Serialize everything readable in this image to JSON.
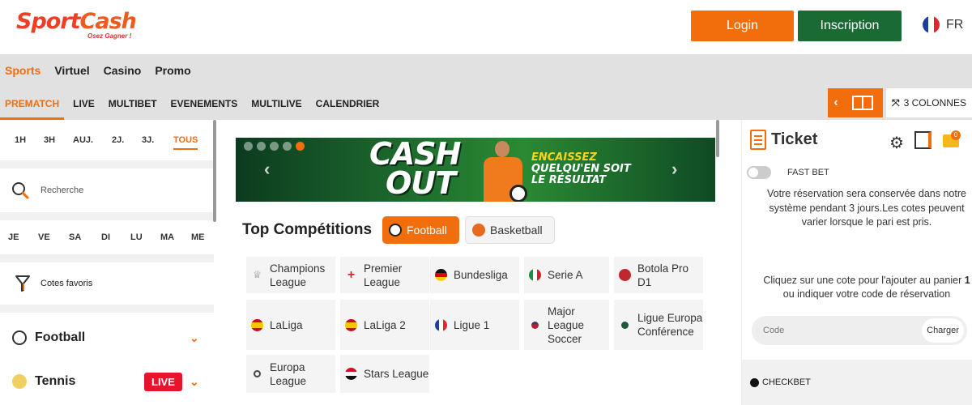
{
  "header": {
    "logo_text_1": "Sport",
    "logo_text_2": "Cash",
    "logo_tagline": "Osez Gagner !",
    "login": "Login",
    "signup": "Inscription",
    "language": "FR"
  },
  "nav_main": [
    "Sports",
    "Virtuel",
    "Casino",
    "Promo"
  ],
  "nav_sub": [
    "PREMATCH",
    "LIVE",
    "MULTIBET",
    "EVENEMENTS",
    "MULTILIVE",
    "CALENDRIER"
  ],
  "layout": {
    "columns_label": "3 COLONNES"
  },
  "sidebar": {
    "periods": [
      "1H",
      "3H",
      "AUJ.",
      "2J.",
      "3J.",
      "TOUS"
    ],
    "search_placeholder": "Recherche",
    "days": [
      "JE",
      "VE",
      "SA",
      "DI",
      "LU",
      "MA",
      "ME"
    ],
    "favorites": "Cotes favoris",
    "sports": [
      {
        "name": "Football",
        "live": ""
      },
      {
        "name": "Tennis",
        "live": "LIVE"
      }
    ]
  },
  "banner": {
    "headline_1": "CASH",
    "headline_2": "OUT",
    "tag_1": "ENCAISSEZ",
    "tag_2": "QUELQU'EN SOIT",
    "tag_3": "LE RÉSULTAT"
  },
  "competitions": {
    "title": "Top Compétitions",
    "tab_football": "Football",
    "tab_basketball": "Basketball",
    "items": [
      "Champions League",
      "Premier League",
      "Bundesliga",
      "Serie A",
      "Botola Pro D1",
      "LaLiga",
      "LaLiga 2",
      "Ligue 1",
      "Major League Soccer",
      "Ligue Europa Conférence",
      "Europa League",
      "Stars League"
    ]
  },
  "ticket": {
    "title": "Ticket",
    "badge": "0",
    "fast_bet": "FAST BET",
    "message": "Votre réservation sera conservée dans notre système pendant 3 jours.Les cotes peuvent varier lorsque le pari est pris.",
    "hint_1": "Cliquez sur une cote pour l'ajouter au panier",
    "hint_num": "1",
    "hint_2": "ou indiquer votre code de réservation",
    "code_placeholder": "Code",
    "charger": "Charger",
    "checkbet": "CHECKBET"
  },
  "colors": {
    "brand_orange": "#f26e0c",
    "brand_green": "#1a6a34",
    "live_red": "#e8142b"
  }
}
